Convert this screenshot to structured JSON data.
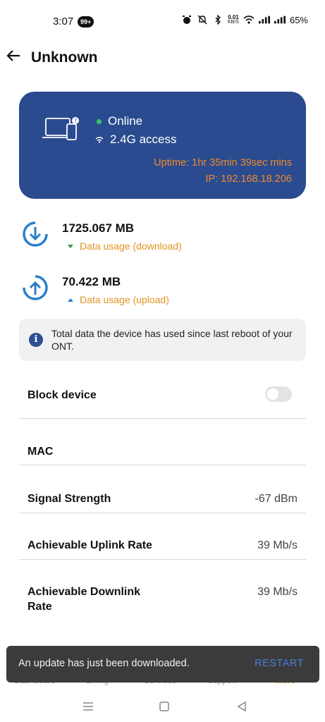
{
  "status_bar": {
    "time": "3:07",
    "badge": "99+",
    "speed_value": "0.01",
    "speed_unit": "KB/S",
    "battery": "65%"
  },
  "header": {
    "title": "Unknown"
  },
  "device_card": {
    "status": "Online",
    "access": "2.4G access",
    "uptime": "Uptime: 1hr 35min 39sec mins",
    "ip": "IP: 192.168.18.206",
    "card_color": "#2a4b8f",
    "accent_color": "#f0892a"
  },
  "usage": {
    "download_value": "1725.067 MB",
    "download_label": "Data usage (download)",
    "upload_value": "70.422 MB",
    "upload_label": "Data usage (upload)"
  },
  "info": {
    "text": "Total data the device has used since last reboot of your ONT."
  },
  "settings": {
    "block_label": "Block device",
    "block_enabled": false,
    "mac_label": "MAC",
    "signal_label": "Signal Strength",
    "signal_value": "-67 dBm",
    "uplink_label": "Achievable Uplink Rate",
    "uplink_value": "39 Mb/s",
    "downlink_label_1": "Achievable Downlink",
    "downlink_label_2": "Rate",
    "downlink_value": "39 Mb/s"
  },
  "bottom_nav": {
    "items": [
      "Dashboard",
      "Billing",
      "Services",
      "Support",
      "More"
    ],
    "active_index": 4
  },
  "snackbar": {
    "message": "An update has just been downloaded.",
    "action": "RESTART"
  },
  "icons": {
    "back": "arrow-left-icon",
    "device": "laptop-phone-icon",
    "wifi": "wifi-icon",
    "download": "download-ring-icon",
    "upload": "upload-ring-icon",
    "info": "info-icon"
  }
}
